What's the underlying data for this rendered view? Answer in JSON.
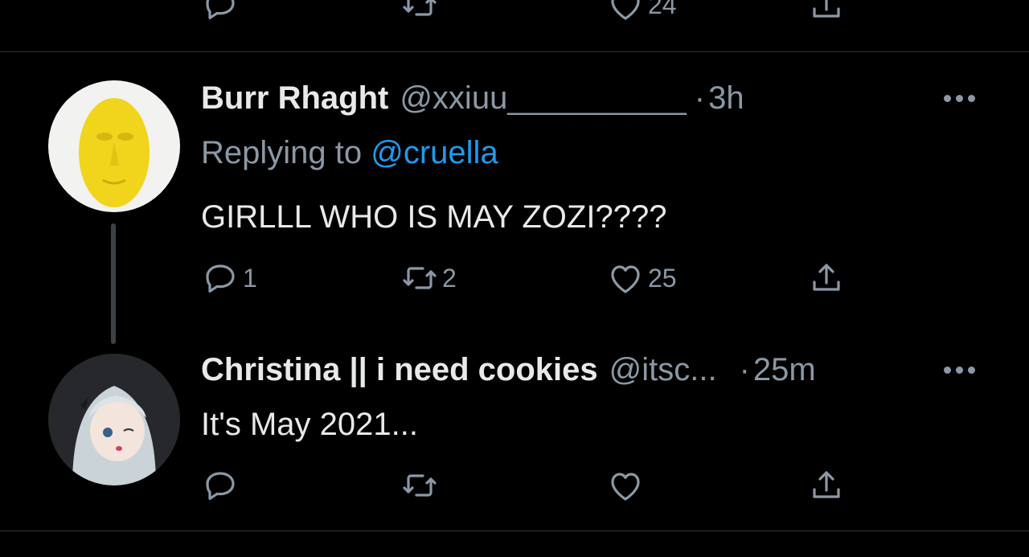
{
  "previous_tweet": {
    "actions": {
      "reply_count": "",
      "retweet_count": "",
      "like_count": "24"
    }
  },
  "tweets": [
    {
      "name": "Burr Rhaght",
      "handle": "@xxiuu__________",
      "dot": "·",
      "time": "3h",
      "replying_prefix": "Replying to",
      "replying_to": "@cruella",
      "text": "GIRLLL WHO IS MAY ZOZI????",
      "actions": {
        "reply_count": "1",
        "retweet_count": "2",
        "like_count": "25"
      }
    },
    {
      "name": "Christina || i need cookies",
      "handle": "@itsc...",
      "dot": "·",
      "time": "25m",
      "text": "It's May 2021...",
      "actions": {
        "reply_count": "",
        "retweet_count": "",
        "like_count": ""
      }
    }
  ],
  "colors": {
    "background": "#000000",
    "primary_text": "#e7e9ea",
    "secondary_text": "#8b98a5",
    "link": "#1d9bf0",
    "divider": "#2f3336"
  },
  "icons": [
    "reply-icon",
    "retweet-icon",
    "like-icon",
    "share-icon",
    "more-icon"
  ]
}
